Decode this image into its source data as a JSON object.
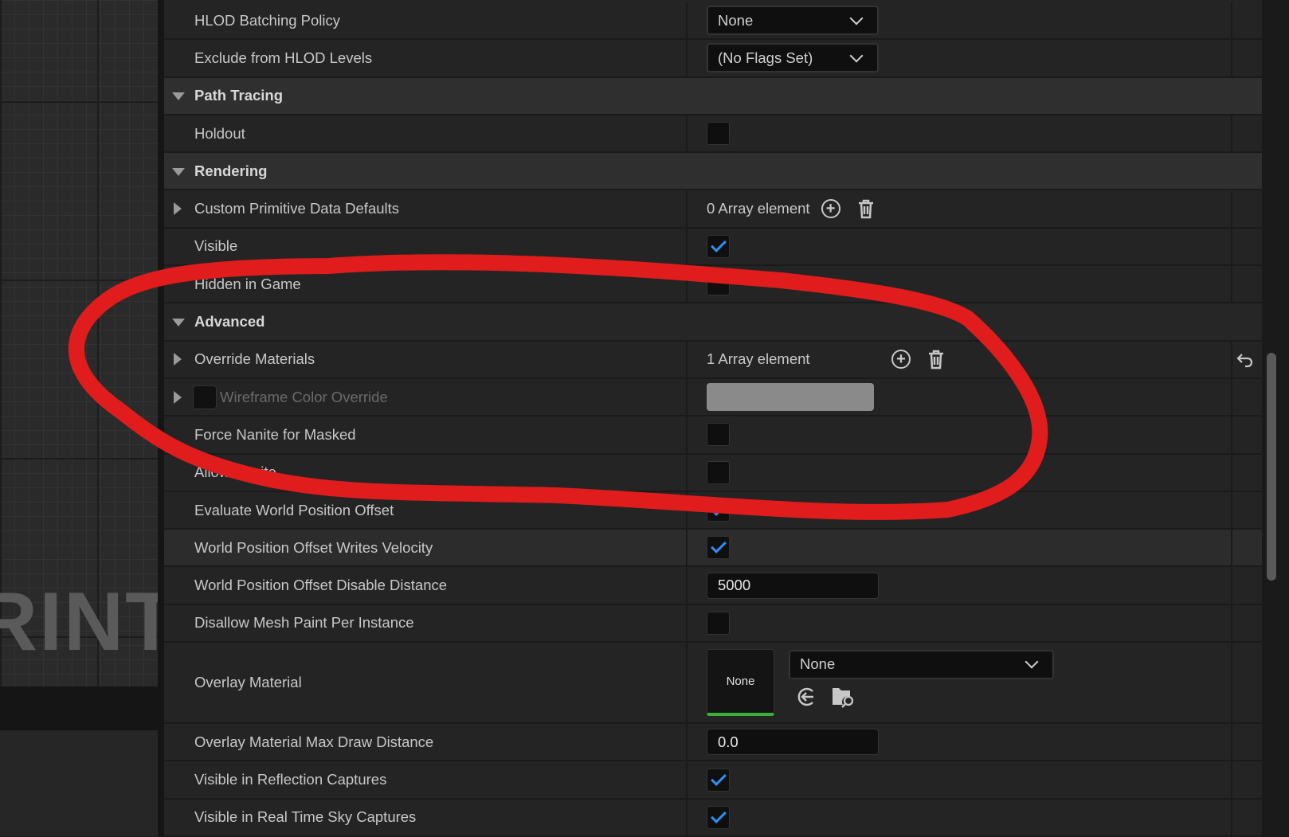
{
  "viewport_watermark": "RINT",
  "rows": [
    {
      "type": "dropdown",
      "label": "HLOD Batching Policy",
      "value": "None"
    },
    {
      "type": "dropdown",
      "label": "Exclude from HLOD Levels",
      "value": "(No Flags Set)"
    },
    {
      "type": "section",
      "label": "Path Tracing"
    },
    {
      "type": "checkbox",
      "label": "Holdout",
      "checked": false
    },
    {
      "type": "section",
      "label": "Rendering"
    },
    {
      "type": "array",
      "label": "Custom Primitive Data Defaults",
      "value": "0 Array element",
      "expandable": true
    },
    {
      "type": "checkbox",
      "label": "Visible",
      "checked": true
    },
    {
      "type": "checkbox",
      "label": "Hidden in Game",
      "checked": false
    },
    {
      "type": "section-light",
      "label": "Advanced"
    },
    {
      "type": "array",
      "label": "Override Materials",
      "value": "1 Array element",
      "expandable": true,
      "reset": true
    },
    {
      "type": "color",
      "label": "Wireframe Color Override",
      "color": "#8a8a8a",
      "disabled": true
    },
    {
      "type": "checkbox",
      "label": "Force Nanite for Masked",
      "checked": false
    },
    {
      "type": "checkbox",
      "label": "Allow Nanite",
      "checked": false
    },
    {
      "type": "checkbox",
      "label": "Evaluate World Position Offset",
      "checked": true
    },
    {
      "type": "checkbox",
      "label": "World Position Offset Writes Velocity",
      "checked": true,
      "highlight": true
    },
    {
      "type": "number",
      "label": "World Position Offset Disable Distance",
      "value": "5000"
    },
    {
      "type": "checkbox",
      "label": "Disallow Mesh Paint Per Instance",
      "checked": false
    },
    {
      "type": "asset",
      "label": "Overlay Material",
      "thumb": "None",
      "value": "None"
    },
    {
      "type": "number",
      "label": "Overlay Material Max Draw Distance",
      "value": "0.0"
    },
    {
      "type": "checkbox",
      "label": "Visible in Reflection Captures",
      "checked": true
    },
    {
      "type": "checkbox",
      "label": "Visible in Real Time Sky Captures",
      "checked": true
    }
  ],
  "colors": {
    "accent_check": "#2f8ff0",
    "annotation": "#e01c1c",
    "asset_bar": "#3ab03a"
  }
}
